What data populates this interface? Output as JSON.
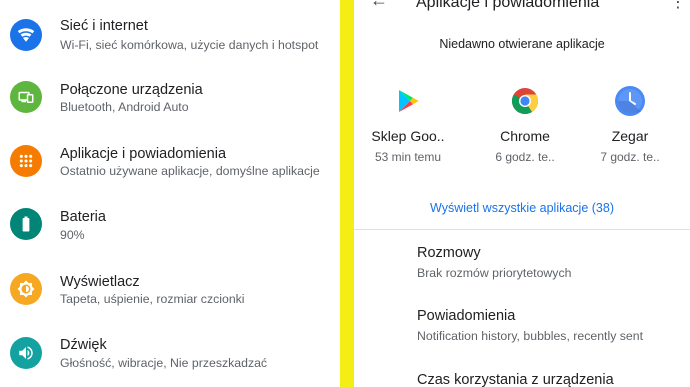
{
  "settings": {
    "items": [
      {
        "title": "Sieć i internet",
        "subtitle": "Wi-Fi, sieć komórkowa, użycie danych i hotspot",
        "icon": "wifi-icon",
        "color": "#1a73e8"
      },
      {
        "title": "Połączone urządzenia",
        "subtitle": "Bluetooth, Android Auto",
        "icon": "connected-devices-icon",
        "color": "#5fb63f"
      },
      {
        "title": "Aplikacje i powiadomienia",
        "subtitle": "Ostatnio używane aplikacje, domyślne aplikacje",
        "icon": "apps-icon",
        "color": "#f57c00"
      },
      {
        "title": "Bateria",
        "subtitle": "90%",
        "icon": "battery-icon",
        "color": "#008577"
      },
      {
        "title": "Wyświetlacz",
        "subtitle": "Tapeta, uśpienie, rozmiar czcionki",
        "icon": "brightness-icon",
        "color": "#f6a823"
      },
      {
        "title": "Dźwięk",
        "subtitle": "Głośność, wibracje, Nie przeszkadzać",
        "icon": "volume-icon",
        "color": "#13a2a0"
      }
    ]
  },
  "apps_screen": {
    "title": "Aplikacje i powiadomienia",
    "recent_header": "Niedawno otwierane aplikacje",
    "recent": [
      {
        "name": "Sklep Goo..",
        "time": "53 min temu",
        "icon": "play-store-icon"
      },
      {
        "name": "Chrome",
        "time": "6 godz. te..",
        "icon": "chrome-icon"
      },
      {
        "name": "Zegar",
        "time": "7 godz. te..",
        "icon": "clock-icon"
      }
    ],
    "see_all": "Wyświetl wszystkie aplikacje (38)",
    "items": [
      {
        "title": "Rozmowy",
        "subtitle": "Brak rozmów priorytetowych"
      },
      {
        "title": "Powiadomienia",
        "subtitle": "Notification history, bubbles, recently sent"
      },
      {
        "title": "Czas korzystania z urządzenia",
        "subtitle": ""
      }
    ]
  },
  "colors": {
    "divider": "#f5ee14",
    "link": "#1a73e8"
  }
}
